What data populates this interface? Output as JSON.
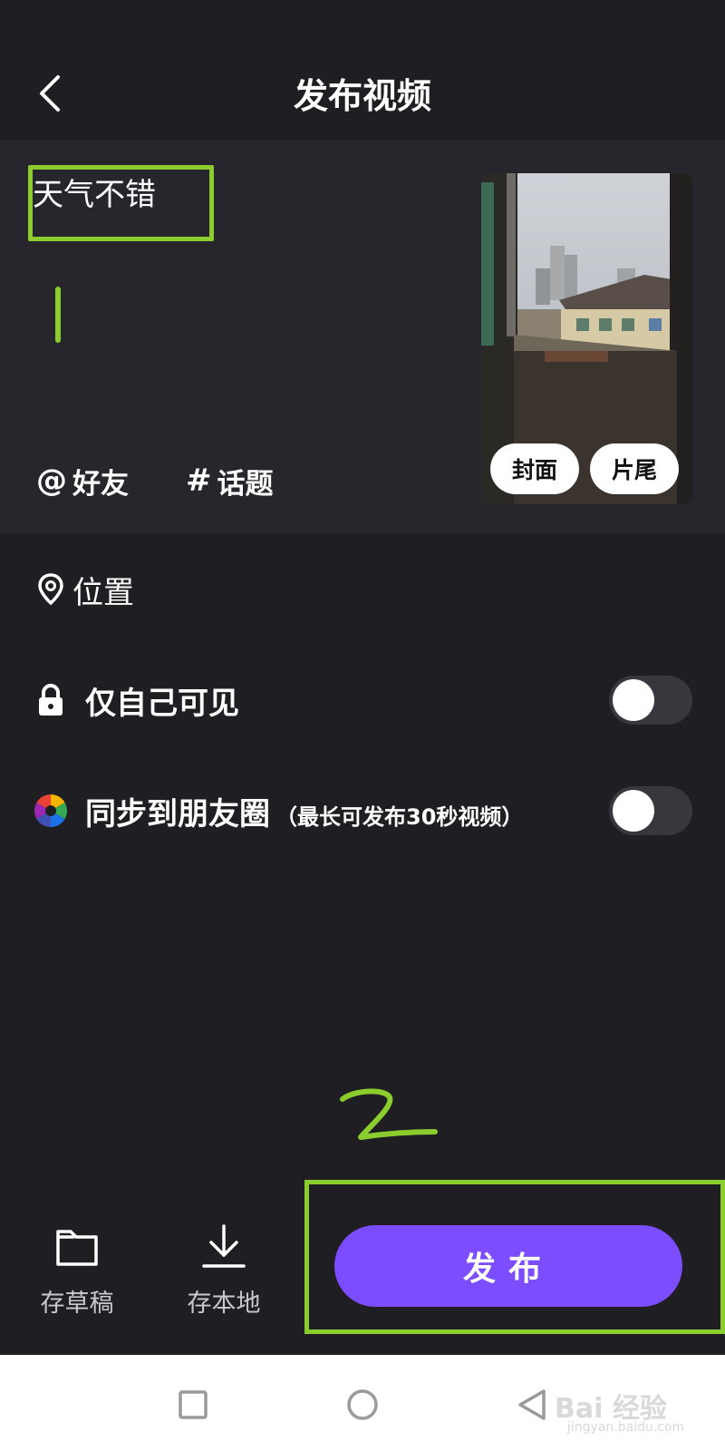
{
  "header": {
    "title": "发布视频"
  },
  "compose": {
    "caption": "天气不错",
    "mention_symbol": "@",
    "mention_label": "好友",
    "topic_symbol": "#",
    "topic_label": "话题",
    "cover_button": "封面",
    "ending_button": "片尾"
  },
  "options": {
    "location_label": "位置",
    "private_label": "仅自己可见",
    "private_on": false,
    "moments_label": "同步到朋友圈",
    "moments_note": "（最长可发布30秒视频）",
    "moments_on": false
  },
  "actions": {
    "draft_label": "存草稿",
    "save_local_label": "存本地",
    "publish_label": "发布"
  },
  "annotations": {
    "color": "#8ccd2e"
  },
  "watermark": {
    "text": "Bai 经验",
    "sub": "jingyan.baidu.com"
  },
  "colors": {
    "background": "#1f1e23",
    "panel": "#27262c",
    "accent": "#7c4dff"
  }
}
